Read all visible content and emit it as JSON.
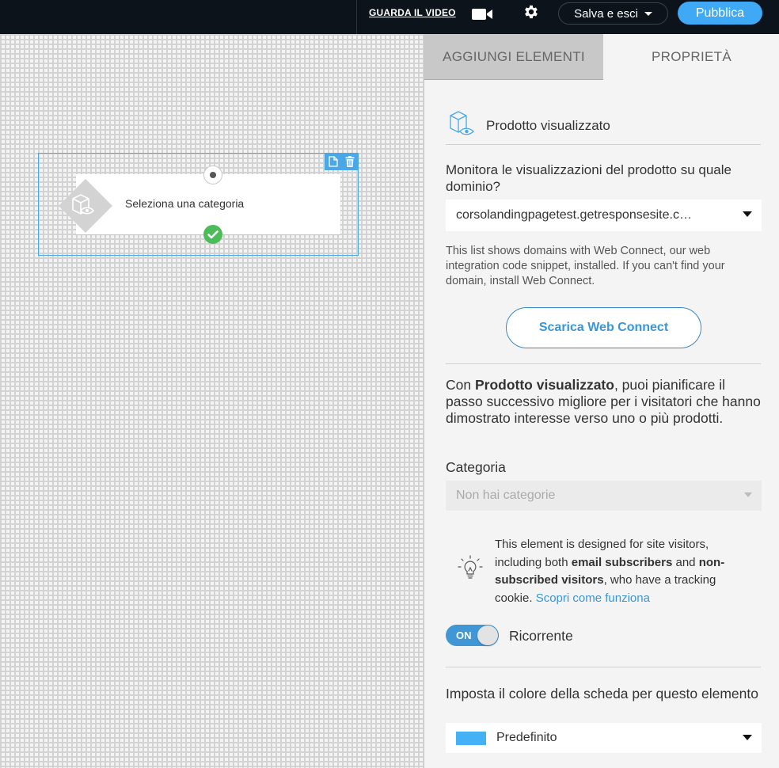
{
  "topbar": {
    "video_link": "GUARDA IL VIDEO",
    "save_label": "Salva e esci",
    "publish_label": "Pubblica"
  },
  "canvas": {
    "node": {
      "label": "Seleziona una categoria"
    }
  },
  "panel": {
    "tabs": [
      {
        "label": "AGGIUNGI ELEMENTI",
        "active": false
      },
      {
        "label": "PROPRIETÀ",
        "active": true
      }
    ],
    "header_title": "Prodotto visualizzato",
    "domain_question": "Monitora le visualizzazioni del prodotto su quale dominio?",
    "domain_value": "corsolandingpagetest.getresponsesite.c…",
    "domain_help": "This list shows domains with Web Connect, our web integration code snippet, installed. If you can't find your domain, install Web Connect.",
    "download_button": "Scarica Web Connect",
    "desc_prefix": "Con ",
    "desc_bold": "Prodotto visualizzato",
    "desc_rest": ", puoi pianificare il passo successivo migliore per i visitatori che hanno dimostrato interesse verso uno o più prodotti.",
    "category_label": "Categoria",
    "category_placeholder": "Non hai categorie",
    "tip_part1": "This element is designed for site visitors, including both ",
    "tip_bold1": "email subscribers",
    "tip_part2": " and ",
    "tip_bold2": "non-subscribed visitors",
    "tip_part3": ", who have a tracking cookie. ",
    "tip_link": "Scopri come funziona",
    "toggle_state": "ON",
    "toggle_label": "Ricorrente",
    "color_label": "Imposta il colore della scheda per questo elemento",
    "color_value": "Predefinito",
    "color_swatch": "#45b1f5"
  },
  "colors": {
    "accent": "#3fa9f5",
    "topbar_bg": "#0d131b",
    "success": "#4cbb5a"
  }
}
